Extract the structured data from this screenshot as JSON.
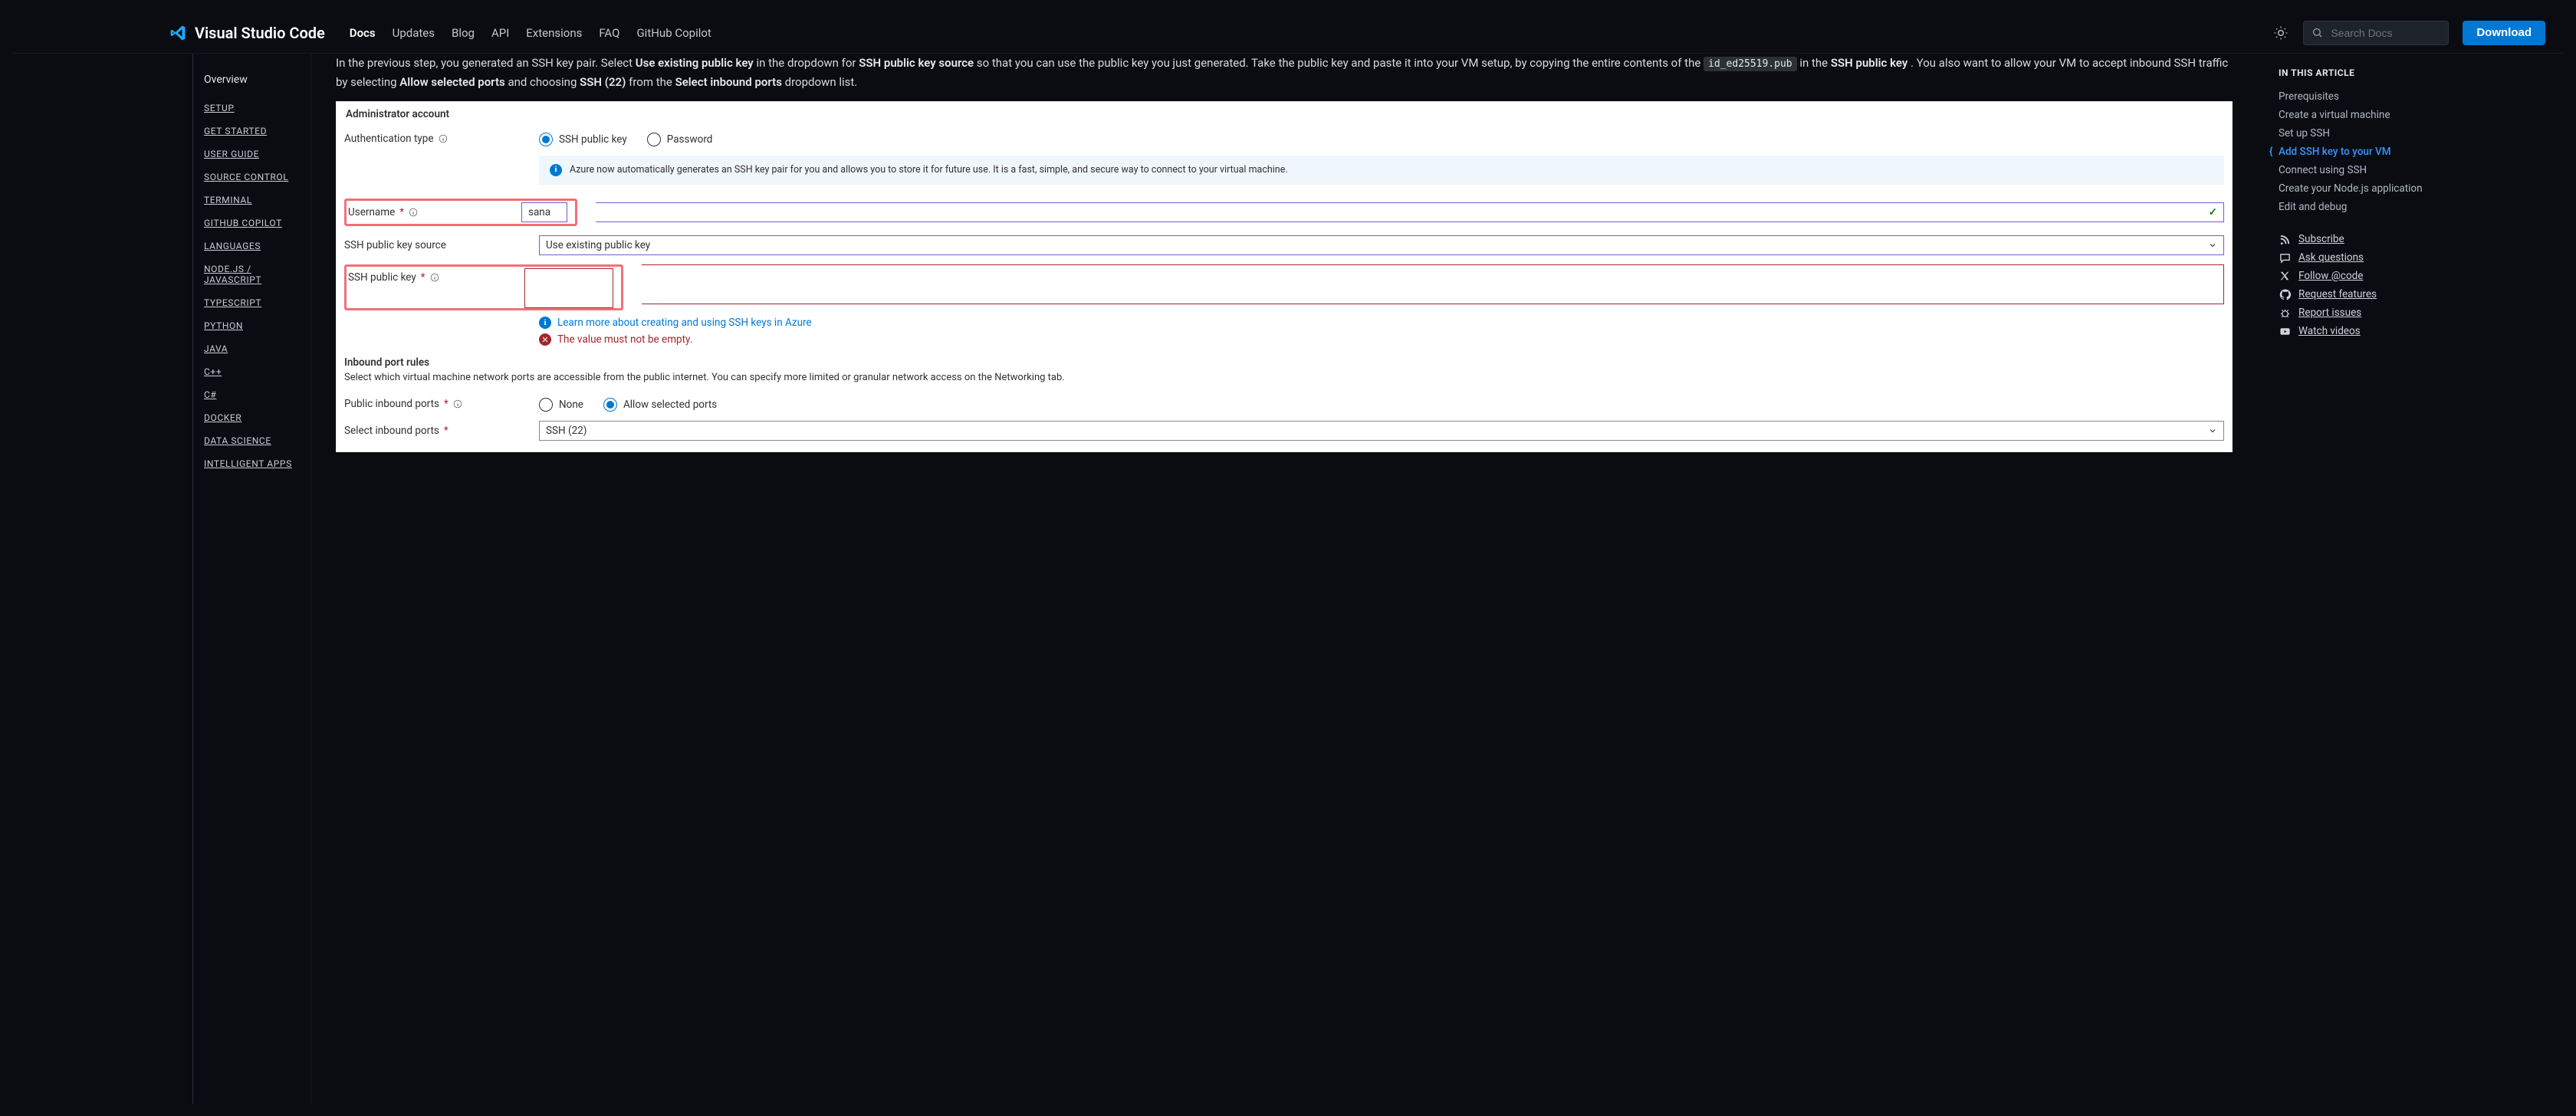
{
  "brand": {
    "title": "Visual Studio Code"
  },
  "nav": {
    "items": [
      "Docs",
      "Updates",
      "Blog",
      "API",
      "Extensions",
      "FAQ",
      "GitHub Copilot"
    ],
    "active_index": 0
  },
  "search": {
    "placeholder": "Search Docs"
  },
  "download_label": "Download",
  "sidebar": {
    "overview": "Overview",
    "categories": [
      "SETUP",
      "GET STARTED",
      "USER GUIDE",
      "SOURCE CONTROL",
      "TERMINAL",
      "GITHUB COPILOT",
      "LANGUAGES",
      "NODE.JS / JAVASCRIPT",
      "TYPESCRIPT",
      "PYTHON",
      "JAVA",
      "C++",
      "C#",
      "DOCKER",
      "DATA SCIENCE",
      "INTELLIGENT APPS"
    ]
  },
  "article": {
    "p1_prefix": "In the previous step, you generated an SSH key pair. Select ",
    "p1_b1": "Use existing public key",
    "p1_mid1": " in the dropdown for ",
    "p1_b2": "SSH public key source",
    "p1_mid2": " so that you can use the public key you just generated. Take the public key and paste it into your VM setup, by copying the entire contents of the ",
    "p1_code": "id_ed25519.pub",
    "p1_mid3": " in the ",
    "p1_b3": "SSH public key",
    "p1_mid4": ". You also want to allow your VM to accept inbound SSH traffic by selecting ",
    "p1_b4": "Allow selected ports",
    "p1_mid5": " and choosing ",
    "p1_b5": "SSH (22)",
    "p1_mid6": " from the ",
    "p1_b6": "Select inbound ports",
    "p1_end": " dropdown list."
  },
  "azure": {
    "section1": "Administrator account",
    "auth_label": "Authentication type",
    "auth_opt1": "SSH public key",
    "auth_opt2": "Password",
    "alert": "Azure now automatically generates an SSH key pair for you and allows you to store it for future use. It is a fast, simple, and secure way to connect to your virtual machine.",
    "username_label": "Username",
    "username_value": "sana",
    "pks_label": "SSH public key source",
    "pks_value": "Use existing public key",
    "pk_label": "SSH public key",
    "learn_link": "Learn more about creating and using SSH keys in Azure",
    "err_msg": "The value must not be empty.",
    "section2": "Inbound port rules",
    "section2_desc": "Select which virtual machine network ports are accessible from the public internet. You can specify more limited or granular network access on the Networking tab.",
    "pip_label": "Public inbound ports",
    "pip_opt1": "None",
    "pip_opt2": "Allow selected ports",
    "sip_label": "Select inbound ports",
    "sip_value": "SSH (22)",
    "req": "*"
  },
  "aside": {
    "title": "IN THIS ARTICLE",
    "toc": [
      {
        "label": "Prerequisites",
        "current": false
      },
      {
        "label": "Create a virtual machine",
        "current": false
      },
      {
        "label": "Set up SSH",
        "current": false
      },
      {
        "label": "Add SSH key to your VM",
        "current": true
      },
      {
        "label": "Connect using SSH",
        "current": false
      },
      {
        "label": "Create your Node.js application",
        "current": false
      },
      {
        "label": "Edit and debug",
        "current": false
      }
    ],
    "feedback": [
      {
        "icon": "rss",
        "label": "Subscribe"
      },
      {
        "icon": "chat",
        "label": "Ask questions"
      },
      {
        "icon": "x",
        "label": "Follow @code"
      },
      {
        "icon": "github",
        "label": "Request features"
      },
      {
        "icon": "bug",
        "label": "Report issues"
      },
      {
        "icon": "video",
        "label": "Watch videos"
      }
    ]
  }
}
